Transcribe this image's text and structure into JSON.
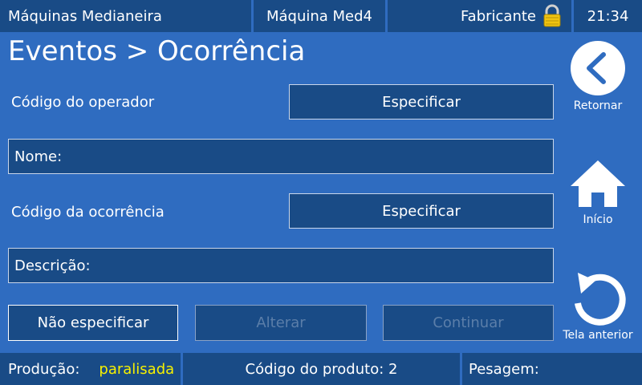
{
  "header": {
    "app_name": "Máquinas Medianeira",
    "machine": "Máquina Med4",
    "user_level": "Fabricante",
    "time": "21:34"
  },
  "page": {
    "title": "Eventos > Ocorrência"
  },
  "form": {
    "operator_code_label": "Código do operador",
    "operator_code_button": "Especificar",
    "name_label": "Nome:",
    "occurrence_code_label": "Código da ocorrência",
    "occurrence_code_button": "Especificar",
    "description_label": "Descrição:"
  },
  "actions": {
    "not_specify": "Não especificar",
    "change": "Alterar",
    "continue": "Continuar"
  },
  "sidebar": {
    "back_label": "Retornar",
    "home_label": "Início",
    "previous_label": "Tela anterior"
  },
  "footer": {
    "production_label": "Produção:",
    "production_status": "paralisada",
    "product_code": "Código do produto: 2",
    "weighing_label": "Pesagem:"
  },
  "colors": {
    "background": "#2f6cc0",
    "bar": "#194b86",
    "status_yellow": "#f6f000"
  }
}
